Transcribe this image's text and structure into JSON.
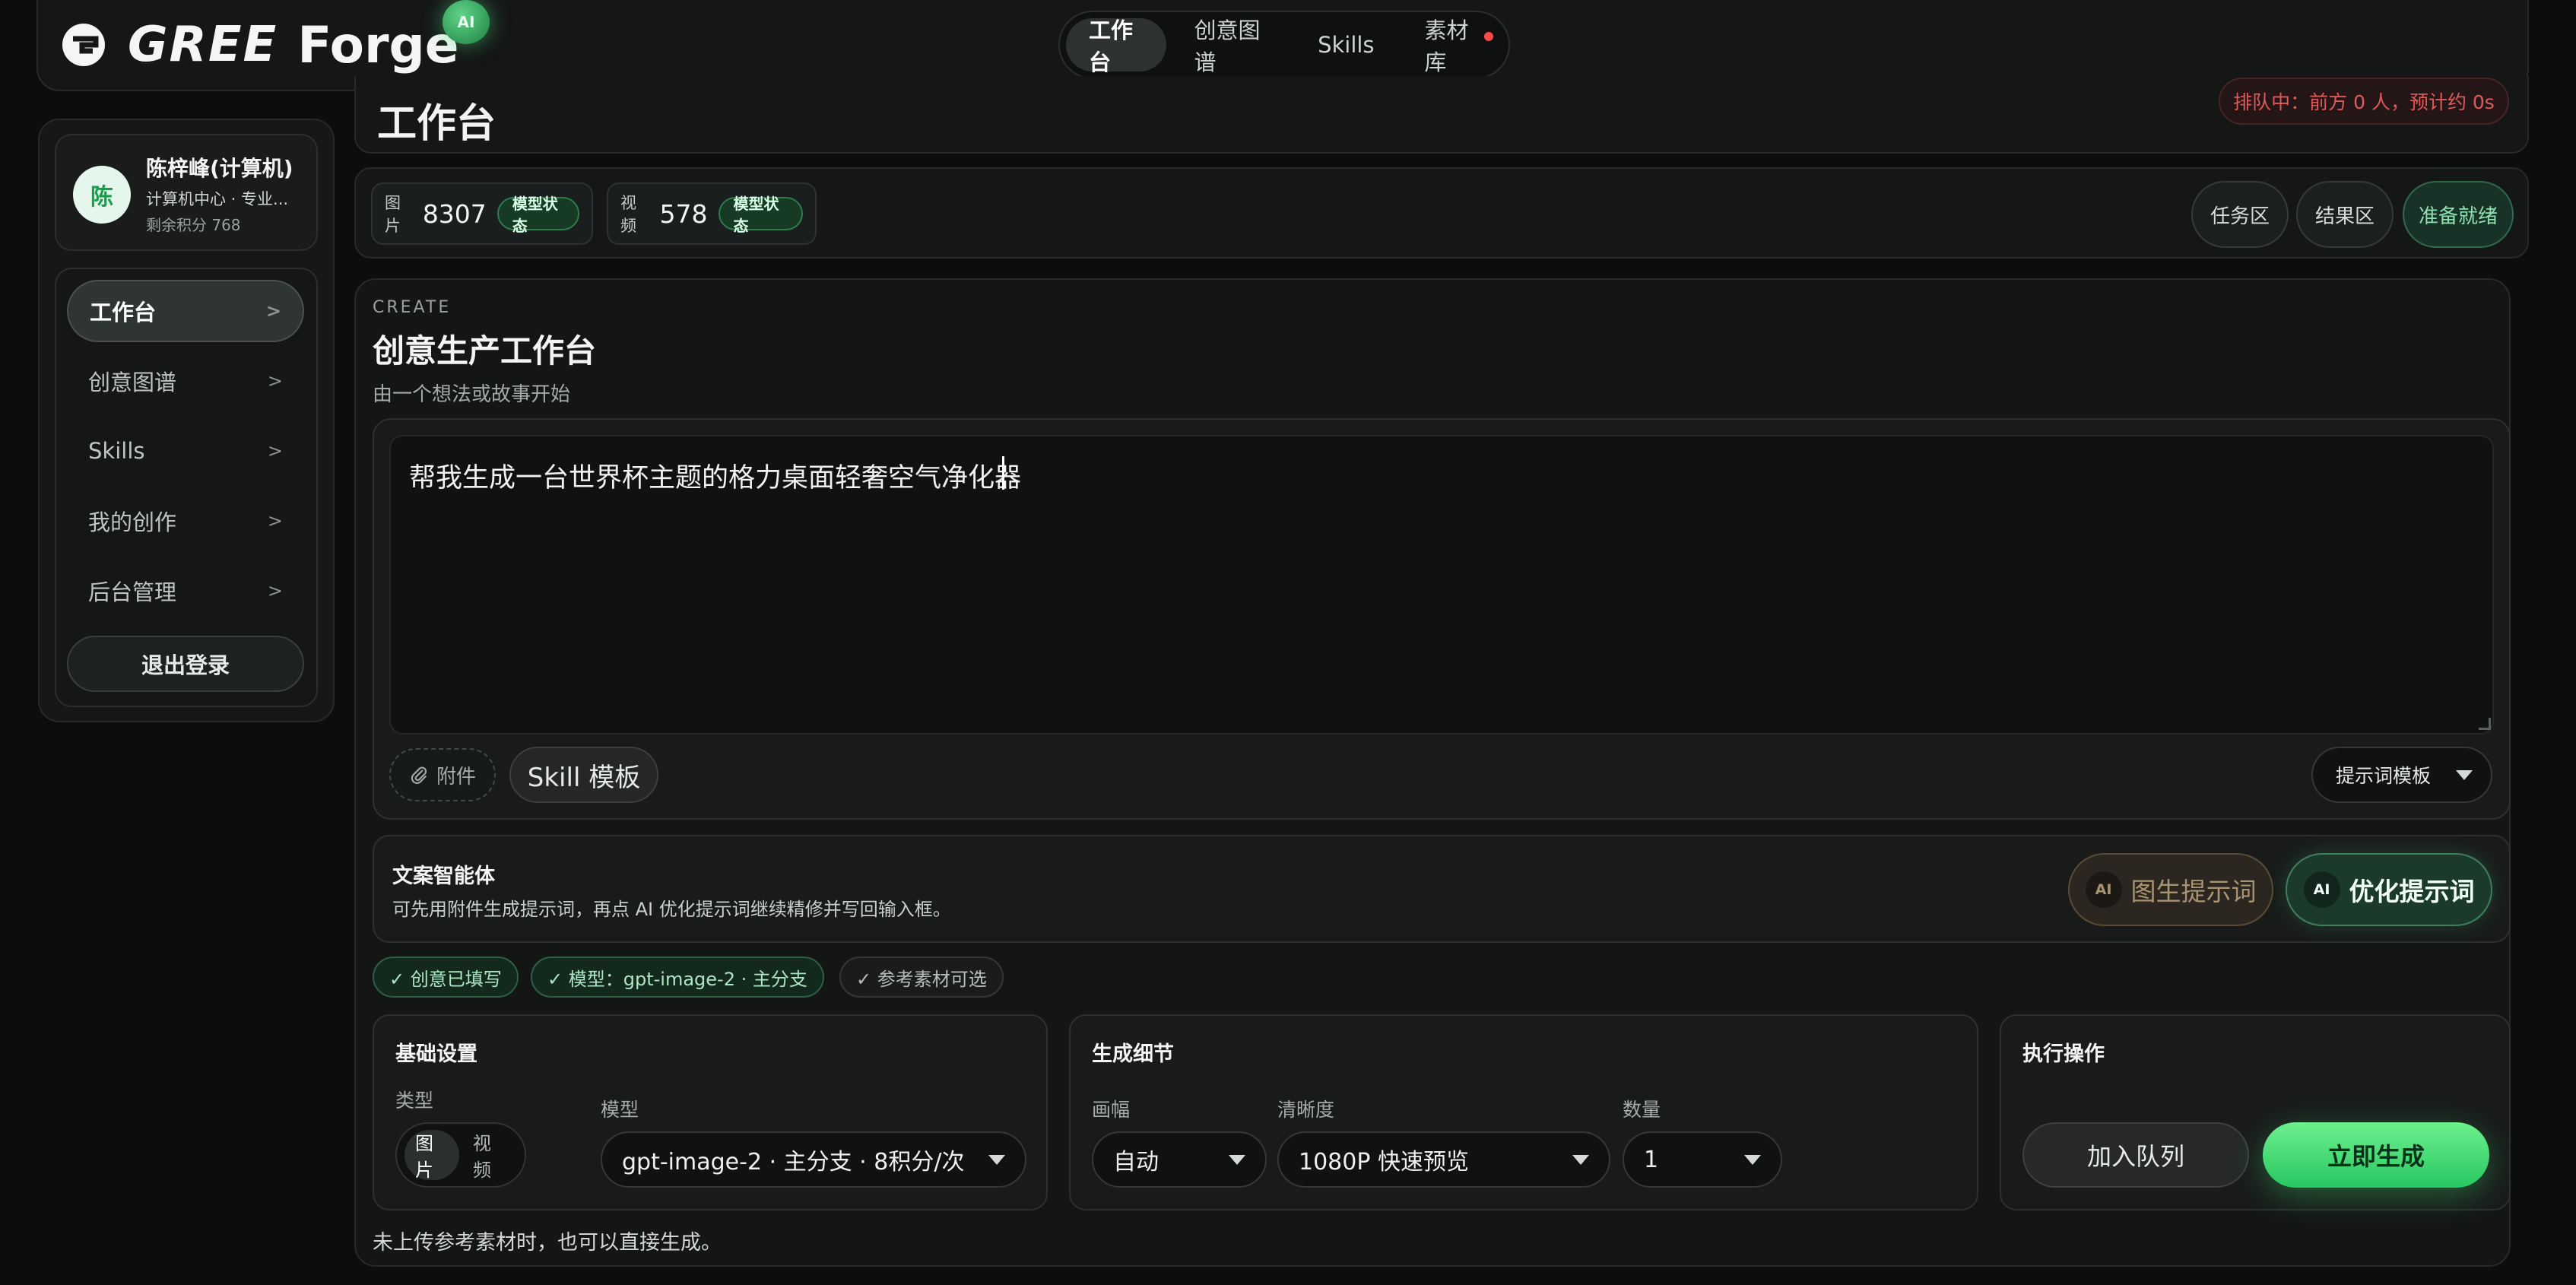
{
  "brand": {
    "name_gree": "GREE",
    "name_forge": "Forge",
    "badge": "AI"
  },
  "nav": {
    "tabs": [
      {
        "label": "工作台",
        "active": true
      },
      {
        "label": "创意图谱",
        "active": false
      },
      {
        "label": "Skills",
        "active": false
      },
      {
        "label": "素材库",
        "active": false,
        "has_dot": true
      }
    ]
  },
  "user": {
    "avatar_initial": "陈",
    "name": "陈梓峰(计算机)",
    "dept": "计算机中心 · 专业...",
    "points": "剩余积分 768"
  },
  "sidebar": {
    "items": [
      {
        "label": "工作台",
        "active": true
      },
      {
        "label": "创意图谱"
      },
      {
        "label": "Skills"
      },
      {
        "label": "我的创作"
      },
      {
        "label": "后台管理"
      }
    ],
    "chevron": ">",
    "logout_label": "退出登录"
  },
  "header": {
    "title": "工作台",
    "queue_status": "排队中：前方 0 人，预计约 0s"
  },
  "stats": {
    "image": {
      "label": "图片",
      "count": "8307",
      "chip": "模型状态"
    },
    "video": {
      "label": "视频",
      "count": "578",
      "chip": "模型状态"
    },
    "buttons": {
      "tasks": "任务区",
      "results": "结果区",
      "ready": "准备就绪"
    }
  },
  "create": {
    "eyebrow": "CREATE",
    "title": "创意生产工作台",
    "subtitle": "由一个想法或故事开始",
    "prompt_value": "帮我生成一台世界杯主题的格力桌面轻奢空气净化器",
    "attach_label": "附件",
    "attach_icon": "paperclip-icon",
    "skill_label": "Skill 模板",
    "template_label": "提示词模板"
  },
  "agent": {
    "title": "文案智能体",
    "desc": "可先用附件生成提示词，再点 AI 优化提示词继续精修并写回输入框。",
    "img_prompt_label": "图生提示词",
    "opt_prompt_label": "优化提示词",
    "ai_tag": "AI"
  },
  "checks": [
    {
      "label": "✓ 创意已填写",
      "style": "green"
    },
    {
      "label": "✓ 模型：gpt-image-2 · 主分支",
      "style": "green"
    },
    {
      "label": "✓ 参考素材可选",
      "style": "gray"
    }
  ],
  "basic": {
    "title": "基础设置",
    "type_label": "类型",
    "type_options": [
      "图片",
      "视频"
    ],
    "model_label": "模型",
    "model_value": "gpt-image-2 · 主分支 · 8积分/次"
  },
  "detail": {
    "title": "生成细节",
    "ratio_label": "画幅",
    "ratio_value": "自动",
    "quality_label": "清晰度",
    "quality_value": "1080P 快速预览",
    "count_label": "数量",
    "count_value": "1"
  },
  "actions": {
    "title": "执行操作",
    "enqueue_label": "加入队列",
    "generate_label": "立即生成"
  },
  "footer_note": "未上传参考素材时，也可以直接生成。",
  "colors": {
    "accent_green": "#28c761",
    "danger": "#e05a5a",
    "background": "#0c0d0d"
  }
}
